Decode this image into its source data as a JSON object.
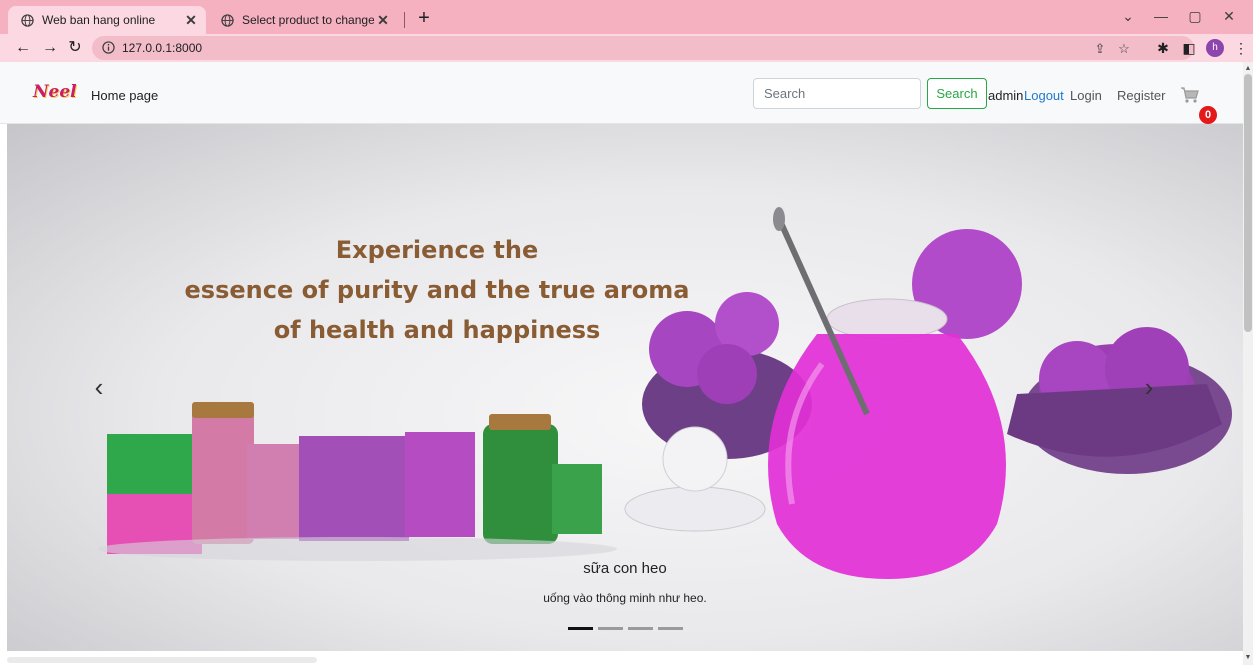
{
  "browser": {
    "tabs": [
      {
        "title": "Web ban hang online",
        "active": true
      },
      {
        "title": "Select product to change | Djang",
        "active": false
      }
    ],
    "url": "127.0.0.1:8000",
    "profile_initial": "h",
    "accent_color": "#f6b1c0"
  },
  "navbar": {
    "logo_text": "Neel",
    "home_label": "Home page",
    "search_placeholder": "Search",
    "search_button": "Search",
    "username": "admin",
    "logout_label": "Logout",
    "login_label": "Login",
    "register_label": "Register",
    "cart_count": "0"
  },
  "carousel": {
    "headline": [
      "Experience the",
      "essence of purity and the true aroma",
      "of health and happiness"
    ],
    "caption_title": "sữa con heo",
    "caption_text": "uống vào thông minh như heo.",
    "slide_count": 4,
    "active_index": 0,
    "prev_icon": "chevron-left-icon",
    "next_icon": "chevron-right-icon"
  }
}
